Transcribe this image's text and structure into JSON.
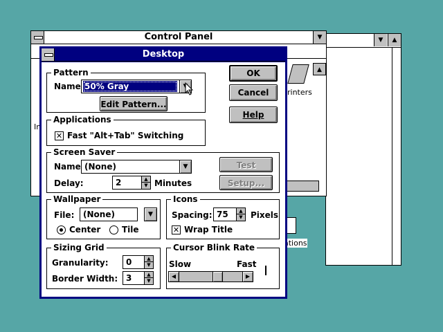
{
  "control_panel": {
    "title": "Control Panel",
    "partial_left_letter": "In",
    "icon_printers_label": "rinters",
    "icon_applications_label": "ations"
  },
  "desktop": {
    "title": "Desktop",
    "ok_label": "OK",
    "cancel_label": "Cancel",
    "help_label": "Help",
    "pattern": {
      "title": "Pattern",
      "name_label": "Name:",
      "name_value": "50% Gray",
      "edit_button": "Edit Pattern..."
    },
    "applications": {
      "title": "Applications",
      "fast_switch_label": "Fast \"Alt+Tab\" Switching",
      "fast_switch_checked": true
    },
    "screen_saver": {
      "title": "Screen Saver",
      "name_label": "Name:",
      "name_value": "(None)",
      "delay_label": "Delay:",
      "delay_value": "2",
      "delay_units": "Minutes",
      "test_button": "Test",
      "setup_button": "Setup..."
    },
    "wallpaper": {
      "title": "Wallpaper",
      "file_label": "File:",
      "file_value": "(None)",
      "center_label": "Center",
      "tile_label": "Tile",
      "center_selected": true
    },
    "icons": {
      "title": "Icons",
      "spacing_label": "Spacing:",
      "spacing_value": "75",
      "spacing_units": "Pixels",
      "wrap_title_label": "Wrap Title",
      "wrap_title_checked": true
    },
    "sizing_grid": {
      "title": "Sizing Grid",
      "granularity_label": "Granularity:",
      "granularity_value": "0",
      "border_width_label": "Border Width:",
      "border_width_value": "3"
    },
    "cursor_blink": {
      "title": "Cursor Blink Rate",
      "slow_label": "Slow",
      "fast_label": "Fast",
      "rate_fraction": 0.63
    }
  },
  "colors": {
    "desktop_bg": "#56a6a6",
    "active_title": "#000080",
    "face": "#c0c0c0"
  }
}
